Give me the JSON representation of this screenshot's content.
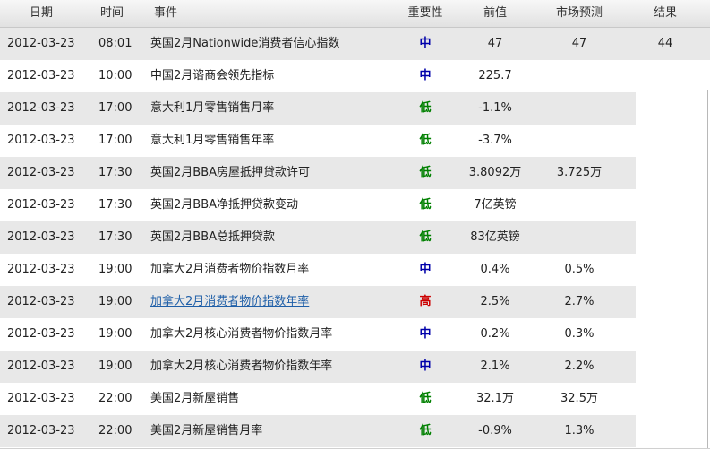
{
  "header": {
    "date": "日期",
    "time": "时间",
    "event": "事件",
    "importance": "重要性",
    "previous": "前值",
    "forecast": "市场预测",
    "result": "结果"
  },
  "colors": {
    "high": "#cc0000",
    "medium": "#0000aa",
    "low": "#008000",
    "link": "#1f5fa8",
    "row_shade": "#e8e8e8"
  },
  "rows": [
    {
      "date": "2012-03-23",
      "time": "08:01",
      "event": "英国2月Nationwide消费者信心指数",
      "importance": "中",
      "importance_level": "medium",
      "previous": "47",
      "forecast": "47",
      "result": "44"
    },
    {
      "date": "2012-03-23",
      "time": "10:00",
      "event": "中国2月谘商会领先指标",
      "importance": "中",
      "importance_level": "medium",
      "previous": "225.7",
      "forecast": "",
      "result": ""
    },
    {
      "date": "2012-03-23",
      "time": "17:00",
      "event": "意大利1月零售销售月率",
      "importance": "低",
      "importance_level": "low",
      "previous": "-1.1%",
      "forecast": "",
      "result": ""
    },
    {
      "date": "2012-03-23",
      "time": "17:00",
      "event": "意大利1月零售销售年率",
      "importance": "低",
      "importance_level": "low",
      "previous": "-3.7%",
      "forecast": "",
      "result": ""
    },
    {
      "date": "2012-03-23",
      "time": "17:30",
      "event": "英国2月BBA房屋抵押贷款许可",
      "importance": "低",
      "importance_level": "low",
      "previous": "3.8092万",
      "forecast": "3.725万",
      "result": ""
    },
    {
      "date": "2012-03-23",
      "time": "17:30",
      "event": "英国2月BBA净抵押贷款变动",
      "importance": "低",
      "importance_level": "low",
      "previous": "7亿英镑",
      "forecast": "",
      "result": ""
    },
    {
      "date": "2012-03-23",
      "time": "17:30",
      "event": "英国2月BBA总抵押贷款",
      "importance": "低",
      "importance_level": "low",
      "previous": "83亿英镑",
      "forecast": "",
      "result": ""
    },
    {
      "date": "2012-03-23",
      "time": "19:00",
      "event": "加拿大2月消费者物价指数月率",
      "importance": "中",
      "importance_level": "medium",
      "previous": "0.4%",
      "forecast": "0.5%",
      "result": ""
    },
    {
      "date": "2012-03-23",
      "time": "19:00",
      "event": "加拿大2月消费者物价指数年率",
      "importance": "高",
      "importance_level": "high",
      "previous": "2.5%",
      "forecast": "2.7%",
      "result": "",
      "link": true
    },
    {
      "date": "2012-03-23",
      "time": "19:00",
      "event": "加拿大2月核心消费者物价指数月率",
      "importance": "中",
      "importance_level": "medium",
      "previous": "0.2%",
      "forecast": "0.3%",
      "result": ""
    },
    {
      "date": "2012-03-23",
      "time": "19:00",
      "event": "加拿大2月核心消费者物价指数年率",
      "importance": "中",
      "importance_level": "medium",
      "previous": "2.1%",
      "forecast": "2.2%",
      "result": ""
    },
    {
      "date": "2012-03-23",
      "time": "22:00",
      "event": "美国2月新屋销售",
      "importance": "低",
      "importance_level": "low",
      "previous": "32.1万",
      "forecast": "32.5万",
      "result": ""
    },
    {
      "date": "2012-03-23",
      "time": "22:00",
      "event": "美国2月新屋销售月率",
      "importance": "低",
      "importance_level": "low",
      "previous": "-0.9%",
      "forecast": "1.3%",
      "result": ""
    }
  ]
}
